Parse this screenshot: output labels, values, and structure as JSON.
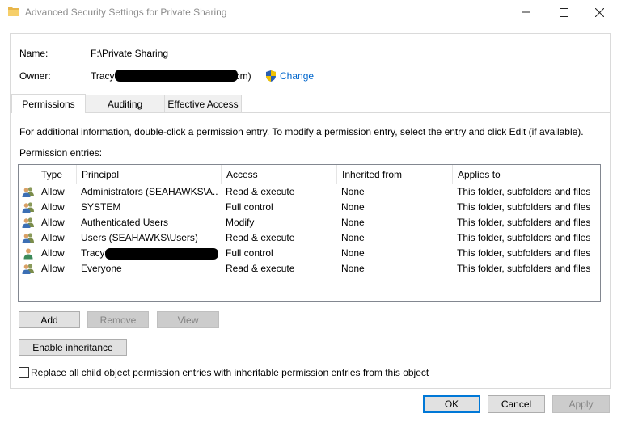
{
  "window": {
    "title": "Advanced Security Settings for Private Sharing"
  },
  "info": {
    "name_label": "Name:",
    "name_value": "F:\\Private Sharing",
    "owner_label": "Owner:",
    "owner_value_start": "Tracy",
    "owner_value_end": "om)",
    "change_label": "Change"
  },
  "tabs": [
    {
      "label": "Permissions",
      "active": true
    },
    {
      "label": "Auditing",
      "active": false
    },
    {
      "label": "Effective Access",
      "active": false
    }
  ],
  "permissions": {
    "info_text": "For additional information, double-click a permission entry. To modify a permission entry, select the entry and click Edit (if available).",
    "entries_label": "Permission entries:",
    "columns": [
      "Type",
      "Principal",
      "Access",
      "Inherited from",
      "Applies to"
    ],
    "rows": [
      {
        "icon": "users-icon",
        "type": "Allow",
        "principal": "Administrators (SEAHAWKS\\A...",
        "access": "Read & execute",
        "inherited": "None",
        "applies": "This folder, subfolders and files"
      },
      {
        "icon": "users-icon",
        "type": "Allow",
        "principal": "SYSTEM",
        "access": "Full control",
        "inherited": "None",
        "applies": "This folder, subfolders and files"
      },
      {
        "icon": "users-icon",
        "type": "Allow",
        "principal": "Authenticated Users",
        "access": "Modify",
        "inherited": "None",
        "applies": "This folder, subfolders and files"
      },
      {
        "icon": "users-icon",
        "type": "Allow",
        "principal": "Users (SEAHAWKS\\Users)",
        "access": "Read & execute",
        "inherited": "None",
        "applies": "This folder, subfolders and files"
      },
      {
        "icon": "user-icon",
        "type": "Allow",
        "principal": "Tracy",
        "access": "Full control",
        "inherited": "None",
        "applies": "This folder, subfolders and files"
      },
      {
        "icon": "users-icon",
        "type": "Allow",
        "principal": "Everyone",
        "access": "Read & execute",
        "inherited": "None",
        "applies": "This folder, subfolders and files"
      }
    ]
  },
  "buttons": {
    "add": "Add",
    "remove": "Remove",
    "view": "View",
    "enable_inheritance": "Enable inheritance",
    "ok": "OK",
    "cancel": "Cancel",
    "apply": "Apply"
  },
  "replace_checkbox": {
    "label": "Replace all child object permission entries with inheritable permission entries from this object",
    "checked": false
  },
  "colors": {
    "link": "#0066cc",
    "default_button_border": "#0078d7",
    "disabled_text": "#838383"
  }
}
